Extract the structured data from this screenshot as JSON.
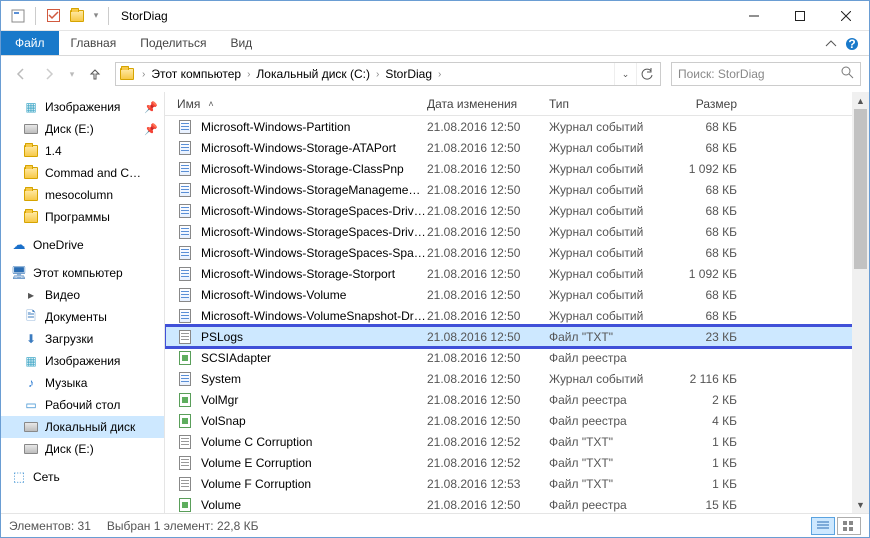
{
  "titlebar": {
    "title": "StorDiag"
  },
  "ribbon": {
    "file": "Файл",
    "tabs": [
      "Главная",
      "Поделиться",
      "Вид"
    ]
  },
  "breadcrumb": [
    "Этот компьютер",
    "Локальный диск (C:)",
    "StorDiag"
  ],
  "search": {
    "placeholder": "Поиск: StorDiag"
  },
  "sidebar": {
    "quick": [
      {
        "label": "Изображения",
        "icon": "pictures",
        "pinned": true
      },
      {
        "label": "Диск (E:)",
        "icon": "drive",
        "pinned": true
      },
      {
        "label": "1.4",
        "icon": "folder"
      },
      {
        "label": "Commad and C…",
        "icon": "folder"
      },
      {
        "label": "mesocolumn",
        "icon": "folder"
      },
      {
        "label": "Программы",
        "icon": "folder"
      }
    ],
    "onedrive": "OneDrive",
    "thispc": "Этот компьютер",
    "thispc_items": [
      {
        "label": "Видео",
        "icon": "video"
      },
      {
        "label": "Документы",
        "icon": "docs"
      },
      {
        "label": "Загрузки",
        "icon": "dl"
      },
      {
        "label": "Изображения",
        "icon": "pictures"
      },
      {
        "label": "Музыка",
        "icon": "music"
      },
      {
        "label": "Рабочий стол",
        "icon": "desk"
      },
      {
        "label": "Локальный диск",
        "icon": "drive",
        "selected": true
      },
      {
        "label": "Диск (E:)",
        "icon": "drive"
      }
    ],
    "network": "Сеть"
  },
  "columns": {
    "name": "Имя",
    "date": "Дата изменения",
    "type": "Тип",
    "size": "Размер"
  },
  "files": [
    {
      "name": "Microsoft-Windows-Partition",
      "date": "21.08.2016 12:50",
      "type": "Журнал событий",
      "size": "68 КБ",
      "icon": "event"
    },
    {
      "name": "Microsoft-Windows-Storage-ATAPort",
      "date": "21.08.2016 12:50",
      "type": "Журнал событий",
      "size": "68 КБ",
      "icon": "event"
    },
    {
      "name": "Microsoft-Windows-Storage-ClassPnp",
      "date": "21.08.2016 12:50",
      "type": "Журнал событий",
      "size": "1 092 КБ",
      "icon": "event"
    },
    {
      "name": "Microsoft-Windows-StorageManagemen…",
      "date": "21.08.2016 12:50",
      "type": "Журнал событий",
      "size": "68 КБ",
      "icon": "event"
    },
    {
      "name": "Microsoft-Windows-StorageSpaces-Driv…",
      "date": "21.08.2016 12:50",
      "type": "Журнал событий",
      "size": "68 КБ",
      "icon": "event"
    },
    {
      "name": "Microsoft-Windows-StorageSpaces-Driv…",
      "date": "21.08.2016 12:50",
      "type": "Журнал событий",
      "size": "68 КБ",
      "icon": "event"
    },
    {
      "name": "Microsoft-Windows-StorageSpaces-Spac…",
      "date": "21.08.2016 12:50",
      "type": "Журнал событий",
      "size": "68 КБ",
      "icon": "event"
    },
    {
      "name": "Microsoft-Windows-Storage-Storport",
      "date": "21.08.2016 12:50",
      "type": "Журнал событий",
      "size": "1 092 КБ",
      "icon": "event"
    },
    {
      "name": "Microsoft-Windows-Volume",
      "date": "21.08.2016 12:50",
      "type": "Журнал событий",
      "size": "68 КБ",
      "icon": "event"
    },
    {
      "name": "Microsoft-Windows-VolumeSnapshot-Dr…",
      "date": "21.08.2016 12:50",
      "type": "Журнал событий",
      "size": "68 КБ",
      "icon": "event"
    },
    {
      "name": "PSLogs",
      "date": "21.08.2016 12:50",
      "type": "Файл \"TXT\"",
      "size": "23 КБ",
      "icon": "txt",
      "selected": true,
      "highlighted": true
    },
    {
      "name": "SCSIAdapter",
      "date": "21.08.2016 12:50",
      "type": "Файл реестра",
      "size": "",
      "icon": "reg"
    },
    {
      "name": "System",
      "date": "21.08.2016 12:50",
      "type": "Журнал событий",
      "size": "2 116 КБ",
      "icon": "event"
    },
    {
      "name": "VolMgr",
      "date": "21.08.2016 12:50",
      "type": "Файл реестра",
      "size": "2 КБ",
      "icon": "reg"
    },
    {
      "name": "VolSnap",
      "date": "21.08.2016 12:50",
      "type": "Файл реестра",
      "size": "4 КБ",
      "icon": "reg"
    },
    {
      "name": "Volume C Corruption",
      "date": "21.08.2016 12:52",
      "type": "Файл \"TXT\"",
      "size": "1 КБ",
      "icon": "txt"
    },
    {
      "name": "Volume E Corruption",
      "date": "21.08.2016 12:52",
      "type": "Файл \"TXT\"",
      "size": "1 КБ",
      "icon": "txt"
    },
    {
      "name": "Volume F Corruption",
      "date": "21.08.2016 12:53",
      "type": "Файл \"TXT\"",
      "size": "1 КБ",
      "icon": "txt"
    },
    {
      "name": "Volume",
      "date": "21.08.2016 12:50",
      "type": "Файл реестра",
      "size": "15 КБ",
      "icon": "reg"
    }
  ],
  "status": {
    "count": "Элементов: 31",
    "selection": "Выбран 1 элемент: 22,8 КБ"
  }
}
